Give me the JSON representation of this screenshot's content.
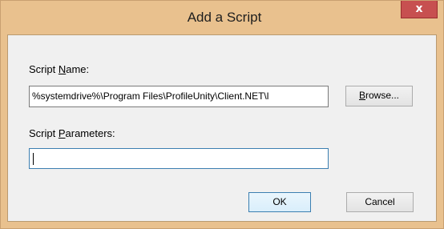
{
  "window": {
    "title": "Add a Script",
    "close_glyph": "x",
    "close_icon": "close-icon"
  },
  "form": {
    "script_name_label_prefix": "Script ",
    "script_name_label_accel": "N",
    "script_name_label_suffix": "ame:",
    "script_name_value": "%systemdrive%\\Program Files\\ProfileUnity\\Client.NET\\l",
    "browse_label_accel": "B",
    "browse_label_suffix": "rowse...",
    "script_params_label_prefix": "Script ",
    "script_params_label_accel": "P",
    "script_params_label_suffix": "arameters:",
    "script_params_value": ""
  },
  "buttons": {
    "ok_label": "OK",
    "cancel_label": "Cancel"
  },
  "colors": {
    "titlebar_accent": "#e9c18e",
    "close_button": "#c75050",
    "client_background": "#f0f0f0",
    "focus_border": "#3c7fb1"
  }
}
